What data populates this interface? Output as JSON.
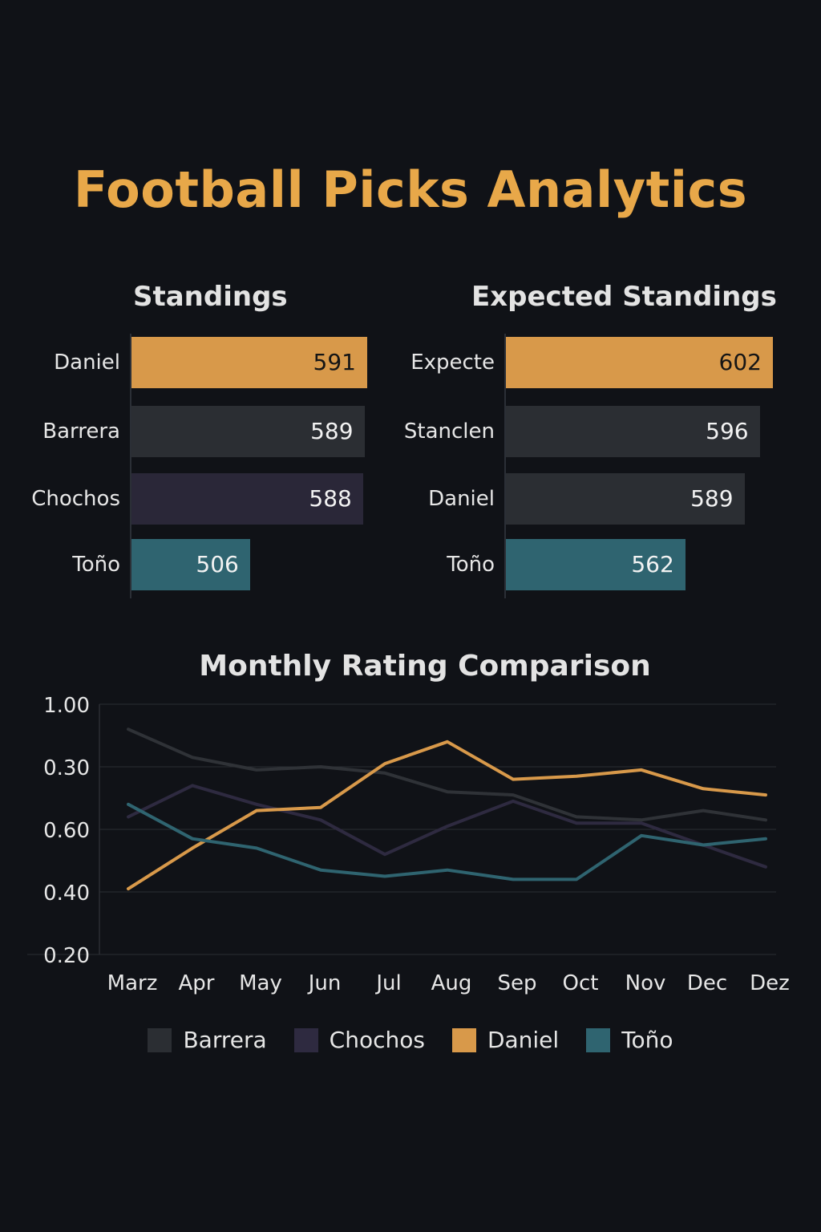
{
  "title": "Football Picks Analytics",
  "colors": {
    "background": "#101217",
    "accent": "#e8a849",
    "daniel": "#d8994a",
    "barrera": "#2b2e33",
    "chochos": "#2a2738",
    "tono": "#2f6470",
    "gridline": "#2a2d33"
  },
  "chart_data": [
    {
      "type": "bar",
      "orientation": "horizontal",
      "title": "Standings",
      "categories": [
        "Daniel",
        "Barrera",
        "Chochos",
        "Toño"
      ],
      "values": [
        591,
        589,
        588,
        506
      ],
      "bar_colors": [
        "#d8994a",
        "#2b2e33",
        "#2a2738",
        "#2f6470"
      ]
    },
    {
      "type": "bar",
      "orientation": "horizontal",
      "title": "Expected Standings",
      "categories": [
        "Expecte",
        "Stanclen",
        "Daniel",
        "Toño"
      ],
      "values": [
        602,
        596,
        589,
        562
      ],
      "bar_colors": [
        "#d8994a",
        "#2b2e33",
        "#2b2e33",
        "#2f6470"
      ]
    },
    {
      "type": "line",
      "title": "Monthly Rating Comparison",
      "xlabel": "",
      "ylabel": "",
      "x": [
        "Marz",
        "Apr",
        "May",
        "Jun",
        "Jul",
        "Aug",
        "Sep",
        "Oct",
        "Nov",
        "Dec",
        "Dez"
      ],
      "y_tick_labels": [
        "1.00",
        "0.30",
        "0.60",
        "0.40",
        "0.20"
      ],
      "grid": true,
      "legend": "bottom",
      "series": [
        {
          "name": "Barrera",
          "color": "#2f3237",
          "values": [
            0.92,
            0.83,
            0.79,
            0.8,
            0.78,
            0.72,
            0.71,
            0.64,
            0.63,
            0.66,
            0.63
          ]
        },
        {
          "name": "Chochos",
          "color": "#2e2a40",
          "values": [
            0.64,
            0.74,
            0.68,
            0.63,
            0.52,
            0.61,
            0.69,
            0.62,
            0.62,
            0.55,
            0.48
          ]
        },
        {
          "name": "Daniel",
          "color": "#d8994a",
          "values": [
            0.41,
            0.54,
            0.66,
            0.67,
            0.81,
            0.88,
            0.76,
            0.77,
            0.79,
            0.73,
            0.71
          ]
        },
        {
          "name": "Toño",
          "color": "#2f6470",
          "values": [
            0.68,
            0.57,
            0.54,
            0.47,
            0.45,
            0.47,
            0.44,
            0.44,
            0.58,
            0.55,
            0.57
          ]
        }
      ]
    }
  ]
}
